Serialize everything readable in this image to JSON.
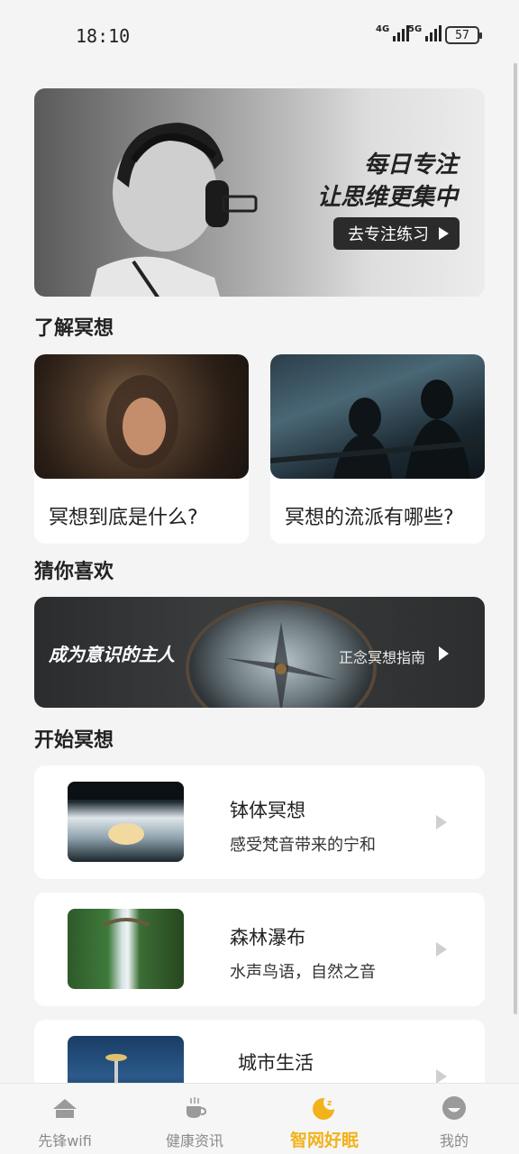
{
  "status_bar": {
    "time": "18:10",
    "network_1": "4G",
    "network_2": "5G",
    "battery": "57"
  },
  "hero": {
    "line1": "每日专注",
    "line2": "让思维更集中",
    "button_label": "去专注练习"
  },
  "section_learn": {
    "title": "了解冥想",
    "cards": [
      {
        "label": "冥想到底是什么?"
      },
      {
        "label": "冥想的流派有哪些?"
      }
    ]
  },
  "section_recommend": {
    "title": "猜你喜欢",
    "banner_title": "成为意识的主人",
    "banner_link": "正念冥想指南"
  },
  "section_start": {
    "title": "开始冥想",
    "items": [
      {
        "name": "钵体冥想",
        "desc": "感受梵音带来的宁和"
      },
      {
        "name": "森林瀑布",
        "desc": "水声鸟语，自然之音"
      },
      {
        "name": "城市生活",
        "desc": ""
      }
    ]
  },
  "tabbar": {
    "tabs": [
      {
        "label": "先锋wifi",
        "icon": "wifi-home-icon"
      },
      {
        "label": "健康资讯",
        "icon": "coffee-cup-icon"
      },
      {
        "label": "智网好眠",
        "icon": "moon-sleep-icon",
        "active": true
      },
      {
        "label": "我的",
        "icon": "profile-icon"
      }
    ],
    "accent_color": "#f2b21a",
    "inactive_color": "#8b8b8b"
  }
}
